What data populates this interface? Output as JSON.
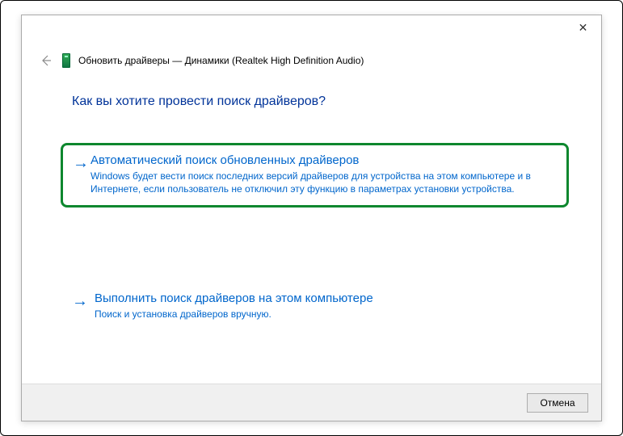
{
  "header": {
    "title": "Обновить драйверы — Динамики (Realtek High Definition Audio)"
  },
  "instruction": "Как вы хотите провести поиск драйверов?",
  "options": [
    {
      "title": "Автоматический поиск обновленных драйверов",
      "desc": "Windows будет вести поиск последних версий драйверов для устройства на этом компьютере и в Интернете, если пользователь не отключил эту функцию в параметрах установки устройства."
    },
    {
      "title": "Выполнить поиск драйверов на этом компьютере",
      "desc": "Поиск и установка драйверов вручную."
    }
  ],
  "footer": {
    "cancel_label": "Отмена"
  },
  "icons": {
    "close": "✕",
    "back": "←",
    "arrow": "→"
  }
}
